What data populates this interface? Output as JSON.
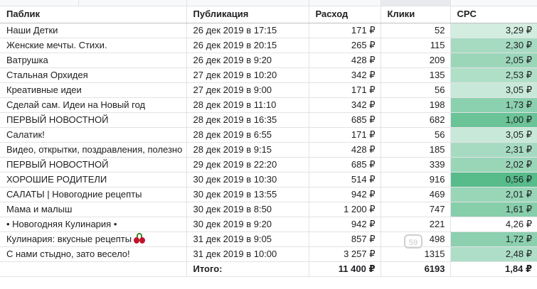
{
  "colors": {
    "grid": "#e2e3e3",
    "cpc_best": "#57bb8a",
    "cpc_worst": "#ffffff"
  },
  "headers": [
    "Паблик",
    "Публикация",
    "Расход",
    "Клики",
    "CPC"
  ],
  "rows": [
    {
      "name": "Наши Детки",
      "date": "26 дек 2019 в 17:15",
      "spend": "171 ₽",
      "clicks": "52",
      "cpc": "3,29 ₽",
      "cpc_value": 3.29
    },
    {
      "name": "Женские мечты. Стихи.",
      "date": "26 дек 2019 в 20:15",
      "spend": "265 ₽",
      "clicks": "115",
      "cpc": "2,30 ₽",
      "cpc_value": 2.3
    },
    {
      "name": "Ватрушка",
      "date": "26 дек 2019 в 9:20",
      "spend": "428 ₽",
      "clicks": "209",
      "cpc": "2,05 ₽",
      "cpc_value": 2.05
    },
    {
      "name": "Стальная Орхидея",
      "date": "27 дек 2019 в 10:20",
      "spend": "342 ₽",
      "clicks": "135",
      "cpc": "2,53 ₽",
      "cpc_value": 2.53
    },
    {
      "name": "Креативные идеи",
      "date": "27 дек 2019 в 9:00",
      "spend": "171 ₽",
      "clicks": "56",
      "cpc": "3,05 ₽",
      "cpc_value": 3.05
    },
    {
      "name": "Сделай сам. Идеи на Новый год",
      "date": "28 дек 2019 в 11:10",
      "spend": "342 ₽",
      "clicks": "198",
      "cpc": "1,73 ₽",
      "cpc_value": 1.73
    },
    {
      "name": "ПЕРВЫЙ НОВОСТНОЙ",
      "date": "28 дек 2019 в 16:35",
      "spend": "685 ₽",
      "clicks": "682",
      "cpc": "1,00 ₽",
      "cpc_value": 1.0
    },
    {
      "name": "Салатик!",
      "date": "28 дек 2019 в 6:55",
      "spend": "171 ₽",
      "clicks": "56",
      "cpc": "3,05 ₽",
      "cpc_value": 3.05
    },
    {
      "name": "Видео, открытки, поздравления, полезно",
      "date": "28 дек 2019 в 9:15",
      "spend": "428 ₽",
      "clicks": "185",
      "cpc": "2,31 ₽",
      "cpc_value": 2.31
    },
    {
      "name": "ПЕРВЫЙ НОВОСТНОЙ",
      "date": "29 дек 2019 в 22:20",
      "spend": "685 ₽",
      "clicks": "339",
      "cpc": "2,02 ₽",
      "cpc_value": 2.02
    },
    {
      "name": "ХОРОШИЕ РОДИТЕЛИ",
      "date": "30 дек 2019 в 10:30",
      "spend": "514 ₽",
      "clicks": "916",
      "cpc": "0,56 ₽",
      "cpc_value": 0.56
    },
    {
      "name": "САЛАТЫ | Новогодние рецепты",
      "date": "30 дек 2019 в 13:55",
      "spend": "942 ₽",
      "clicks": "469",
      "cpc": "2,01 ₽",
      "cpc_value": 2.01
    },
    {
      "name": "Мама и малыш",
      "date": "30 дек 2019 в 8:50",
      "spend": "1 200 ₽",
      "clicks": "747",
      "cpc": "1,61 ₽",
      "cpc_value": 1.61
    },
    {
      "name": "• Новогодняя Кулинария •",
      "date": "30 дек 2019 в 9:20",
      "spend": "942 ₽",
      "clicks": "221",
      "cpc": "4,26 ₽",
      "cpc_value": 4.26
    },
    {
      "name": "Кулинария: вкусные рецепты",
      "date": "31 дек 2019 в 9:05",
      "spend": "857 ₽",
      "clicks": "498",
      "cpc": "1,72 ₽",
      "cpc_value": 1.72,
      "icon": "cherry-icon"
    },
    {
      "name": "С нами стыдно, зато весело!",
      "date": "31 дек 2019 в 10:00",
      "spend": "3 257 ₽",
      "clicks": "1315",
      "cpc": "2,48 ₽",
      "cpc_value": 2.48
    }
  ],
  "total": {
    "label": "Итого:",
    "spend": "11 400 ₽",
    "clicks": "6193",
    "cpc": "1,84 ₽"
  }
}
